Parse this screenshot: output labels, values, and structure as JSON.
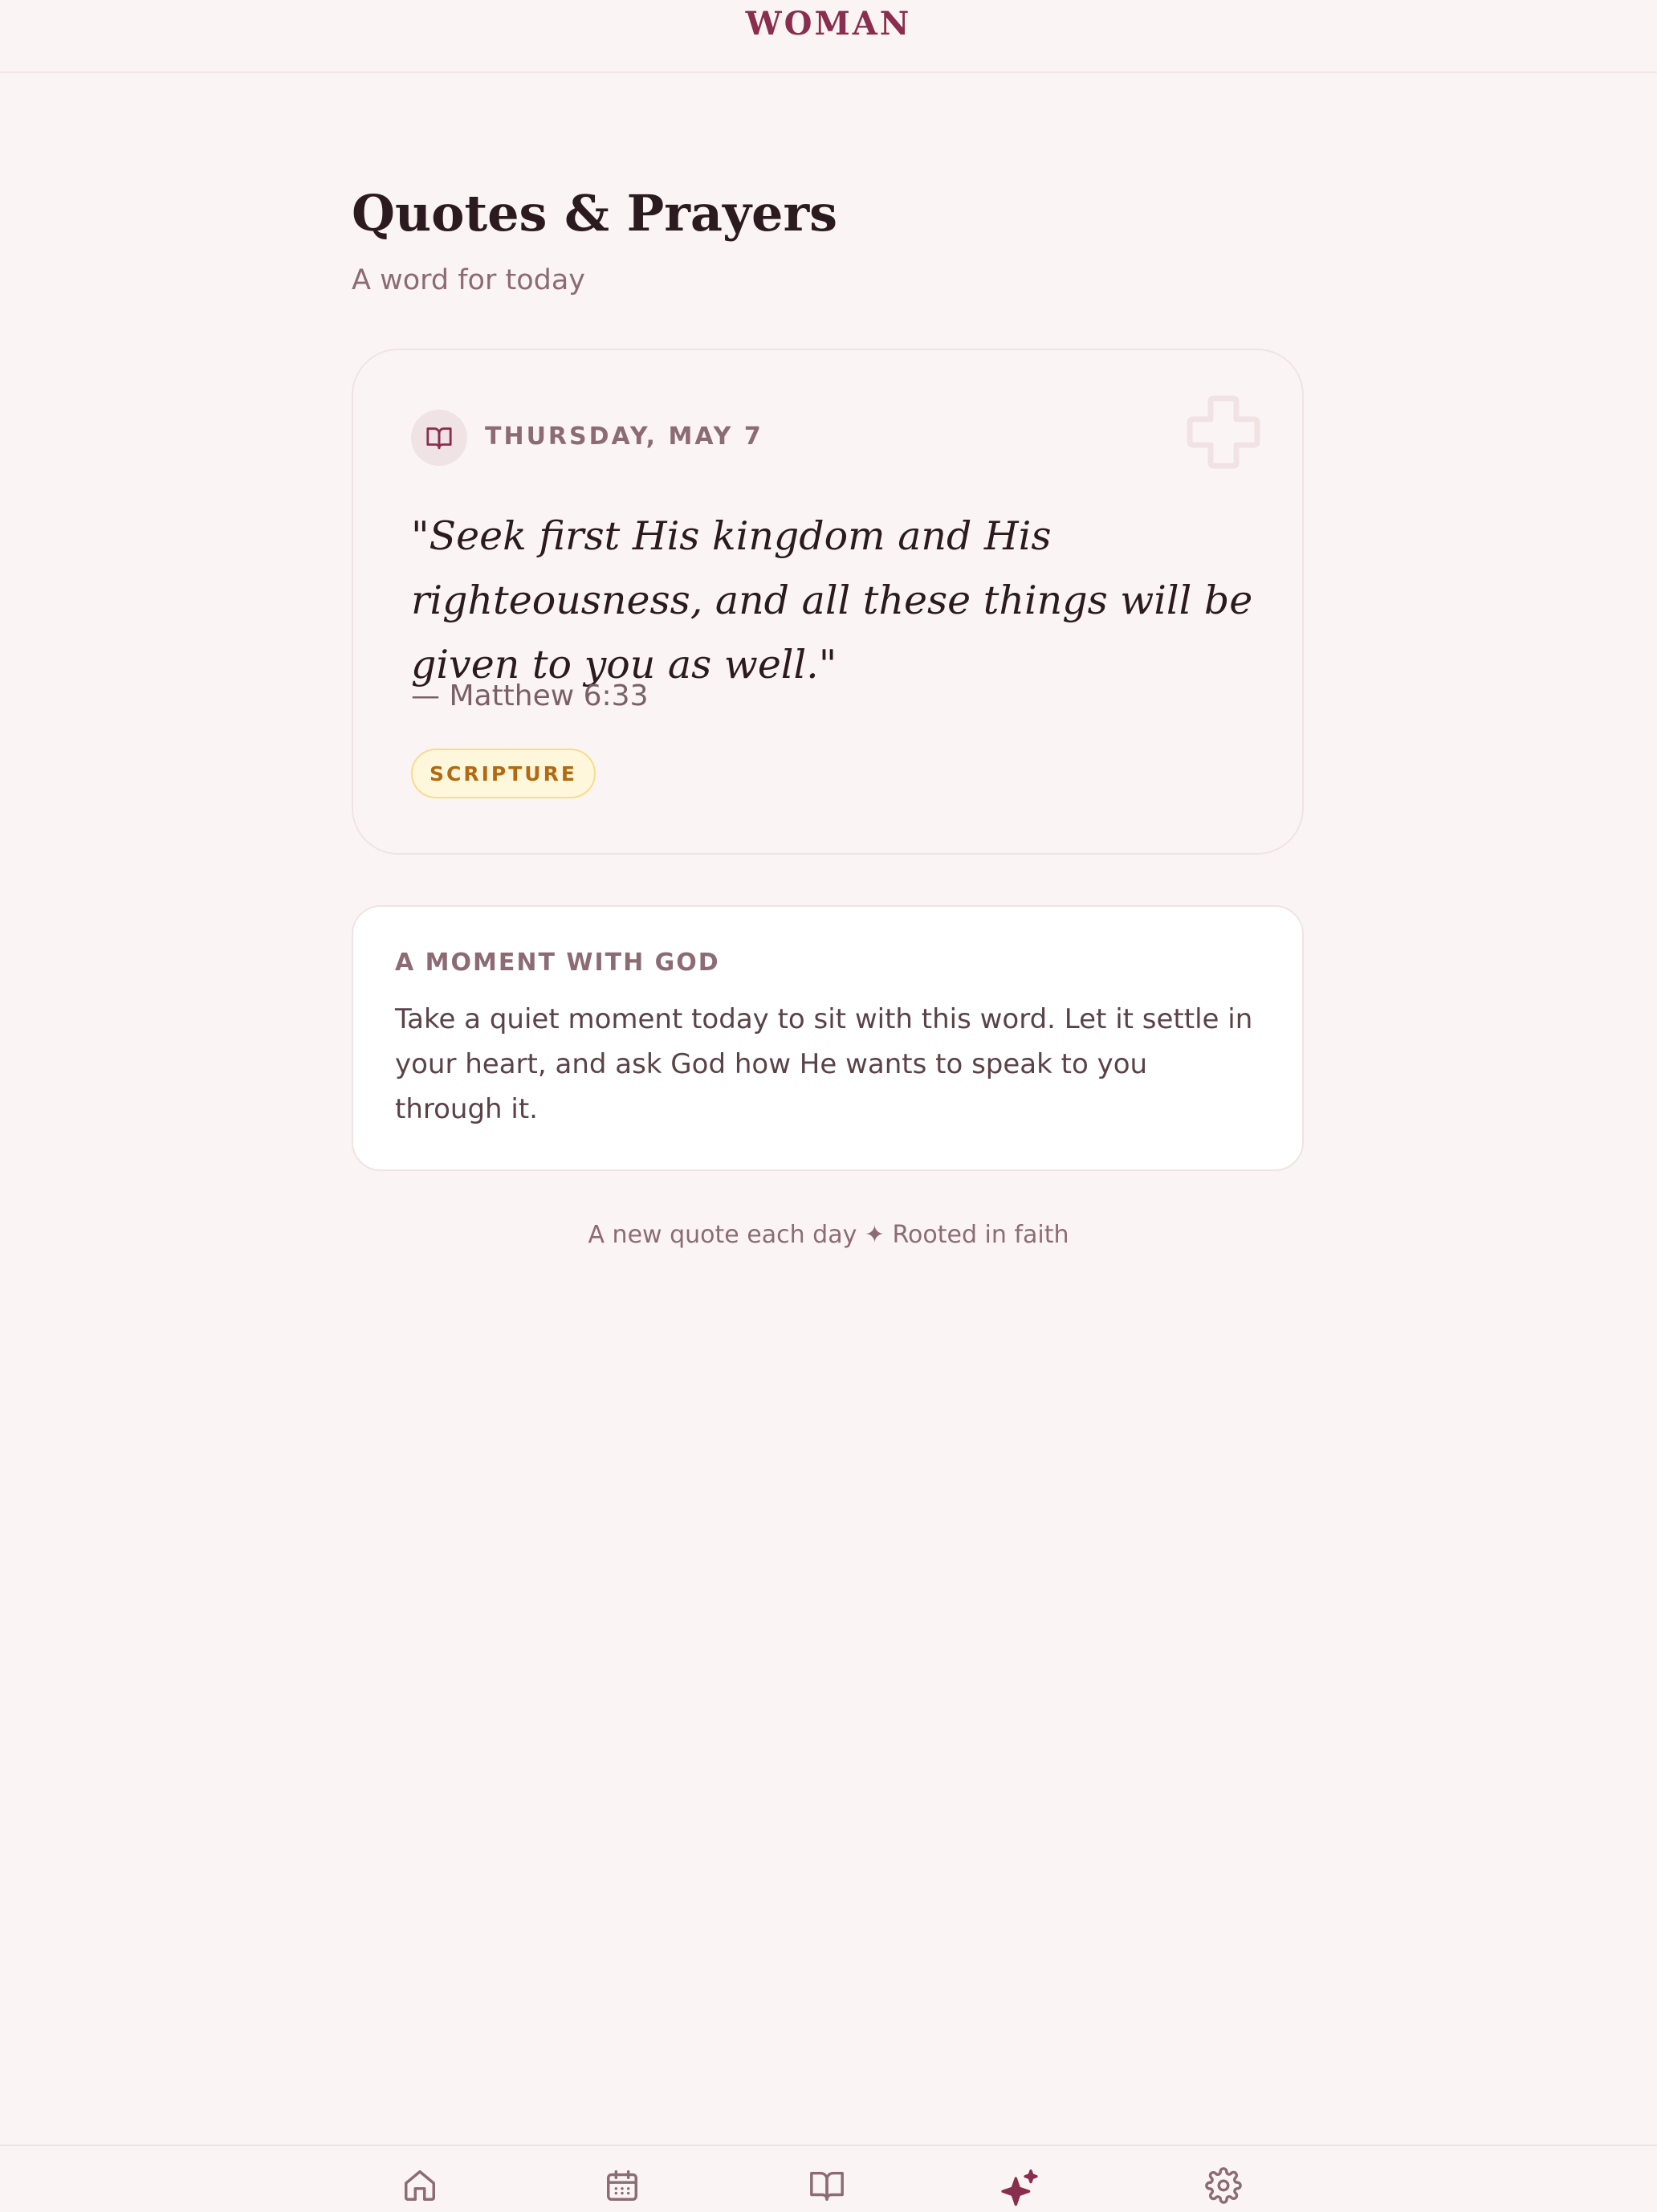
{
  "app": {
    "brand": "WOMAN"
  },
  "header": {
    "title": "Quotes & Prayers",
    "subtitle": "A word for today"
  },
  "quote_card": {
    "date": "THURSDAY, MAY 7",
    "quote": "\"Seek first His kingdom and His righteousness, and all these things will be given to you as well.\"",
    "reference": "— Matthew 6:33",
    "tag": "SCRIPTURE",
    "date_icon": "book-open-icon",
    "decor_icon": "cross-icon"
  },
  "moment_card": {
    "heading": "A MOMENT WITH GOD",
    "body": "Take a quiet moment today to sit with this word. Let it settle in your heart, and ask God how He wants to speak to you through it."
  },
  "footer": {
    "note": "A new quote each day ✦ Rooted in faith"
  },
  "tabs": [
    {
      "icon": "home-icon",
      "active": false
    },
    {
      "icon": "calendar-icon",
      "active": false
    },
    {
      "icon": "book-open-icon",
      "active": false
    },
    {
      "icon": "sparkles-icon",
      "active": true
    },
    {
      "icon": "gear-icon",
      "active": false
    }
  ],
  "colors": {
    "accent": "#8a2e4f",
    "background": "#faf5f4",
    "muted": "#8c6b75",
    "tag_text": "#b26a12",
    "tag_bg": "#fff7dc"
  }
}
